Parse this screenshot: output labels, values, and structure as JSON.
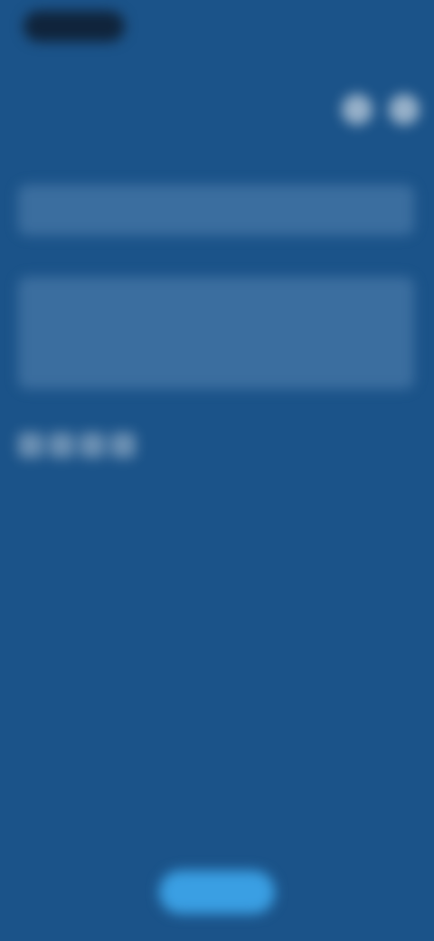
{
  "status_bar": {
    "time": ""
  },
  "nav": {
    "back_label": "",
    "title": "",
    "actions": [
      {
        "icon": "circle-icon",
        "glyph": ""
      },
      {
        "icon": "circle-icon",
        "glyph": ""
      }
    ]
  },
  "form": {
    "field1": {
      "label": "",
      "value": "",
      "placeholder": ""
    },
    "field2": {
      "label": "",
      "value": "",
      "placeholder": ""
    }
  },
  "chips": [
    "",
    "",
    "",
    ""
  ],
  "meta": {
    "title": "",
    "lines": [
      "",
      ""
    ]
  },
  "primary_action": {
    "label": ""
  },
  "colors": {
    "background": "#1b5389",
    "input_fill": "#4f80ad",
    "primary_button": "#3a9fe3",
    "status_pill": "#10243b"
  }
}
